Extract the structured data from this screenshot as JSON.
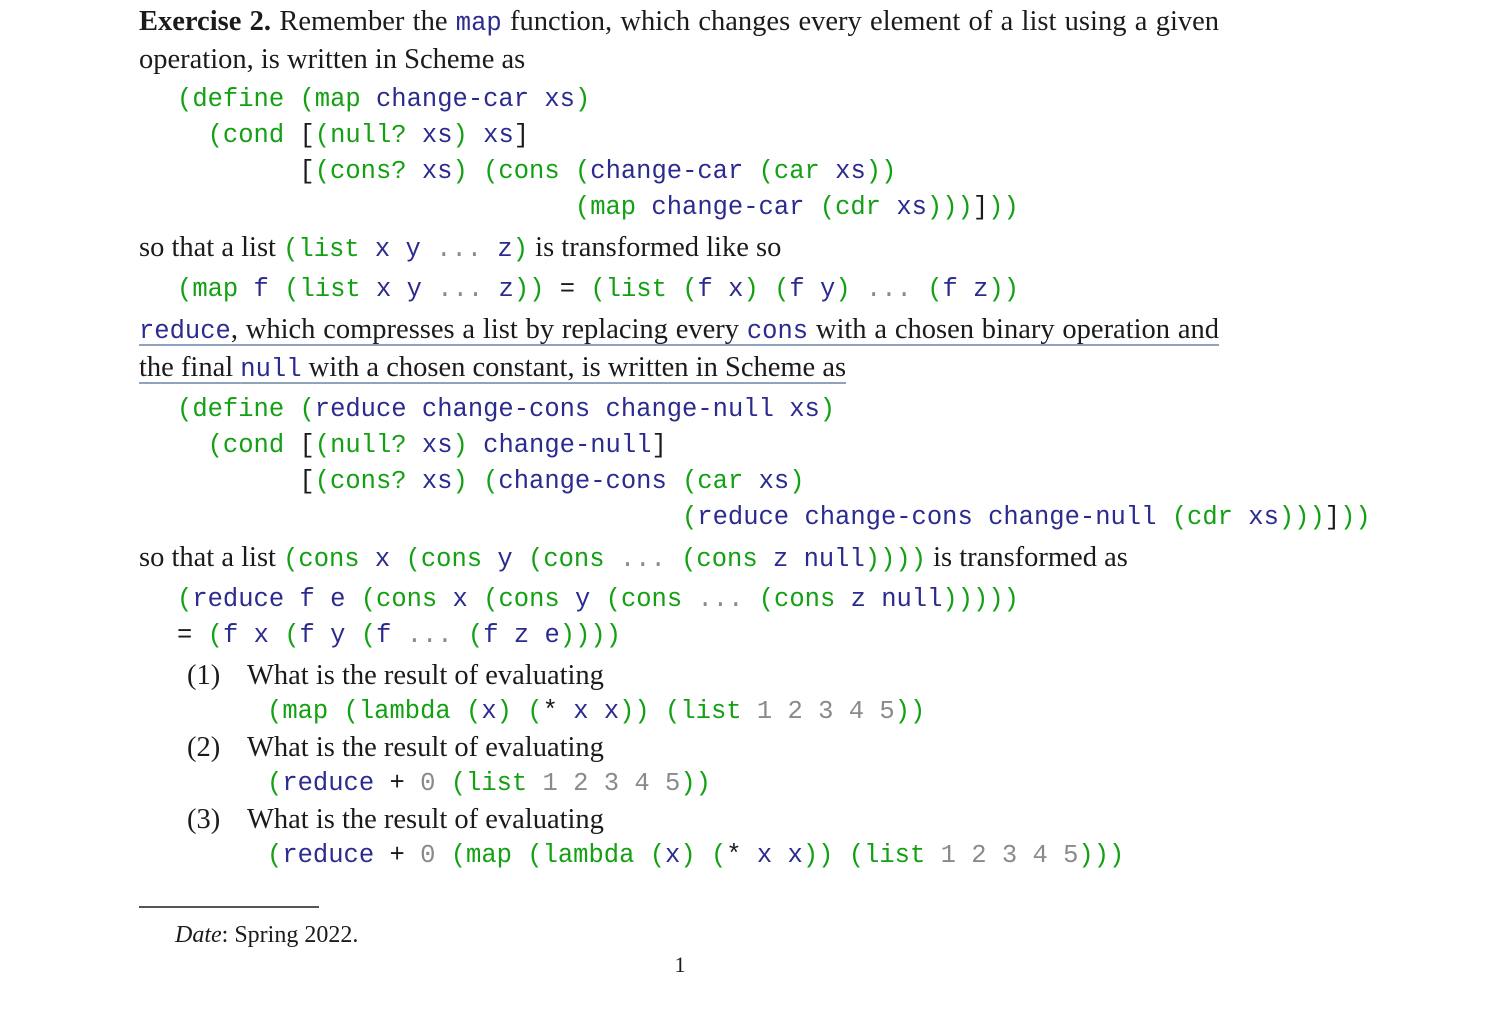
{
  "document": {
    "page_number": "1",
    "footnote_rule": true,
    "date_label": "Date",
    "date_value": ": Spring 2022."
  },
  "colors": {
    "keyword_green": "#13a013",
    "identifier_navy": "#2b2b8f",
    "operator_black": "#1b1b1b",
    "numeral_grey": "#8a8a8a",
    "link_underline": "#8fa3bb",
    "body_text": "#1b1b1b",
    "page_background": "#ffffff"
  },
  "exercise": {
    "label": "Exercise 2.",
    "intro_text": " Remember the ",
    "intro_code_map": "map",
    "intro_text_2": " function, which changes every element of a list using a given operation, is written in Scheme as"
  },
  "code_map_definition": {
    "lines": [
      "(define (map change-car xs)",
      "  (cond [(null? xs) xs]",
      "        [(cons? xs) (cons (change-car (car xs))",
      "                          (map change-car (cdr xs)))]))"
    ]
  },
  "transform_map": {
    "lead_text": "so that a list ",
    "inline_code": "(list x y ... z)",
    "tail_text": " is transformed like so",
    "equation": "(map f (list x y ... z)) = (list (f x) (f y) ... (f z))"
  },
  "reduce_paragraph": {
    "code_reduce": "reduce",
    "text_1": ", which compresses a list by replacing every ",
    "code_cons": "cons",
    "text_2": " with a chosen binary operation and the final ",
    "code_null": "null",
    "text_3": " with a chosen constant, is written in Scheme as"
  },
  "code_reduce_definition": {
    "lines": [
      "(define (reduce change-cons change-null xs)",
      "  (cond [(null? xs) change-null]",
      "        [(cons? xs) (change-cons (car xs)",
      "                                 (reduce change-cons change-null (cdr xs)))]))"
    ]
  },
  "transform_reduce": {
    "lead_text": "so that a list ",
    "inline_code": "(cons x (cons y (cons ... (cons z null))))",
    "tail_text": " is transformed as",
    "equation_line_1": "(reduce f e (cons x (cons y (cons ... (cons z null)))))",
    "equation_line_2": "= (f x (f y (f ... (f z e))))"
  },
  "questions": [
    {
      "number": "(1)",
      "prompt": "What is the result of evaluating",
      "code": "(map (lambda (x) (* x x)) (list 1 2 3 4 5))"
    },
    {
      "number": "(2)",
      "prompt": "What is the result of evaluating",
      "code": "(reduce + 0 (list 1 2 3 4 5))"
    },
    {
      "number": "(3)",
      "prompt": "What is the result of evaluating",
      "code": "(reduce + 0 (map (lambda (x) (* x x)) (list 1 2 3 4 5)))"
    }
  ]
}
